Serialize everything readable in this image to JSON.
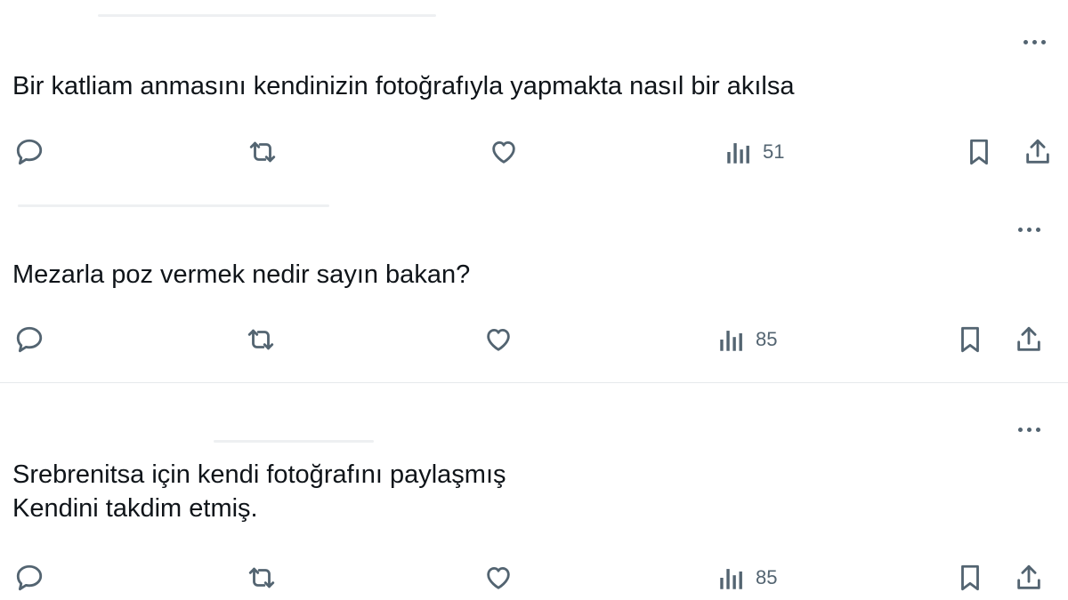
{
  "replies": [
    {
      "text_lines": [
        "Bir katliam anmasını kendinizin fotoğrafıyla yapmakta nasıl bir akılsa"
      ],
      "views": "51"
    },
    {
      "text_lines": [
        "Mezarla poz vermek nedir sayın bakan?"
      ],
      "views": "85"
    },
    {
      "text_lines": [
        "Srebrenitsa için kendi fotoğrafını paylaşmış",
        "Kendini takdim etmiş."
      ],
      "views": "85"
    }
  ],
  "icons": {
    "more": "more-horizontal-icon",
    "reply": "reply-icon",
    "retweet": "retweet-icon",
    "like": "heart-icon",
    "views": "views-icon",
    "bookmark": "bookmark-icon",
    "share": "share-icon"
  },
  "colors": {
    "text": "#0f1419",
    "icon": "#536471",
    "divider": "#e6e9ec",
    "background": "#ffffff"
  }
}
